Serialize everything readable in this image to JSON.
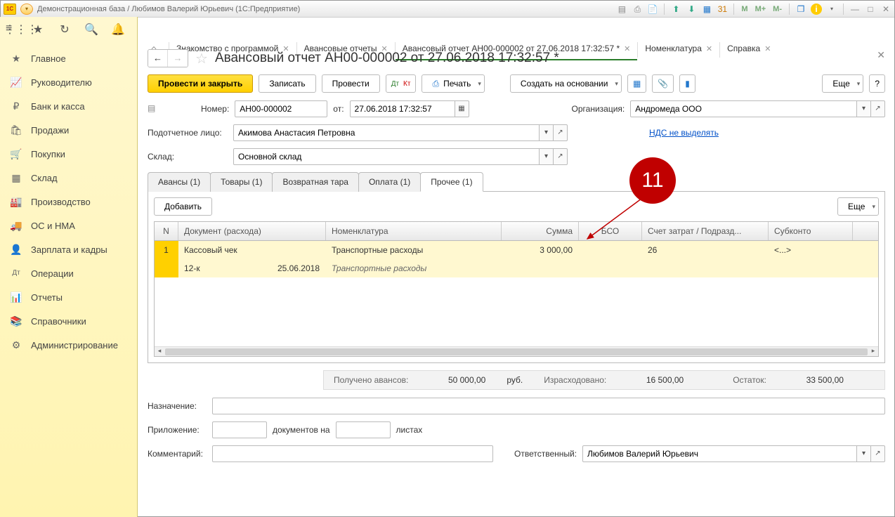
{
  "titlebar": {
    "text": "Демонстрационная база / Любимов Валерий Юрьевич  (1С:Предприятие)",
    "m": "M",
    "mplus": "M+",
    "mminus": "M-"
  },
  "tabs": [
    {
      "label": "Знакомство с программой"
    },
    {
      "label": "Авансовые отчеты"
    },
    {
      "label": "Авансовый отчет АН00-000002 от 27.06.2018 17:32:57 *",
      "active": true
    },
    {
      "label": "Номенклатура"
    },
    {
      "label": "Справка"
    }
  ],
  "sidebar": [
    {
      "icon": "★",
      "label": "Главное"
    },
    {
      "icon": "📈",
      "label": "Руководителю"
    },
    {
      "icon": "₽",
      "label": "Банк и касса"
    },
    {
      "icon": "🛍",
      "label": "Продажи"
    },
    {
      "icon": "🛒",
      "label": "Покупки"
    },
    {
      "icon": "▦",
      "label": "Склад"
    },
    {
      "icon": "🏭",
      "label": "Производство"
    },
    {
      "icon": "🚚",
      "label": "ОС и НМА"
    },
    {
      "icon": "👤",
      "label": "Зарплата и кадры"
    },
    {
      "icon": "Дт",
      "label": "Операции"
    },
    {
      "icon": "📊",
      "label": "Отчеты"
    },
    {
      "icon": "📚",
      "label": "Справочники"
    },
    {
      "icon": "⚙",
      "label": "Администрирование"
    }
  ],
  "page_title": "Авансовый отчет АН00-000002 от 27.06.2018 17:32:57 *",
  "cmd": {
    "post_close": "Провести и закрыть",
    "write": "Записать",
    "post": "Провести",
    "print": "Печать",
    "create_based": "Создать на основании",
    "more": "Еще",
    "help": "?"
  },
  "form": {
    "number_lbl": "Номер:",
    "number": "АН00-000002",
    "from_lbl": "от:",
    "date": "27.06.2018 17:32:57",
    "org_lbl": "Организация:",
    "org": "Андромеда ООО",
    "person_lbl": "Подотчетное лицо:",
    "person": "Акимова Анастасия Петровна",
    "nds_link": "НДС не выделять",
    "wh_lbl": "Склад:",
    "wh": "Основной склад"
  },
  "subtabs": [
    {
      "label": "Авансы (1)"
    },
    {
      "label": "Товары (1)"
    },
    {
      "label": "Возвратная тара"
    },
    {
      "label": "Оплата (1)"
    },
    {
      "label": "Прочее (1)",
      "active": true
    }
  ],
  "tab_buttons": {
    "add": "Добавить",
    "more": "Еще"
  },
  "columns": {
    "n": "N",
    "doc": "Документ (расхода)",
    "nom": "Номенклатура",
    "sum": "Сумма",
    "bso": "БСО",
    "acc": "Счет затрат / Подразд...",
    "sub": "Субконто"
  },
  "row": {
    "n": "1",
    "doc": "Кассовый чек",
    "nom": "Транспортные расходы",
    "sum": "3 000,00",
    "bso": "",
    "acc": "26",
    "sub": "<...>",
    "doc2": "12-к",
    "date2": "25.06.2018",
    "nom2": "Транспортные расходы"
  },
  "totals": {
    "adv_lbl": "Получено авансов:",
    "adv": "50 000,00",
    "cur": "руб.",
    "spent_lbl": "Израсходовано:",
    "spent": "16 500,00",
    "rest_lbl": "Остаток:",
    "rest": "33 500,00"
  },
  "bottom": {
    "purpose_lbl": "Назначение:",
    "attach_lbl": "Приложение:",
    "docs_on": "документов на",
    "sheets": "листах",
    "comment_lbl": "Комментарий:",
    "resp_lbl": "Ответственный:",
    "resp": "Любимов Валерий Юрьевич"
  },
  "callout": "11"
}
